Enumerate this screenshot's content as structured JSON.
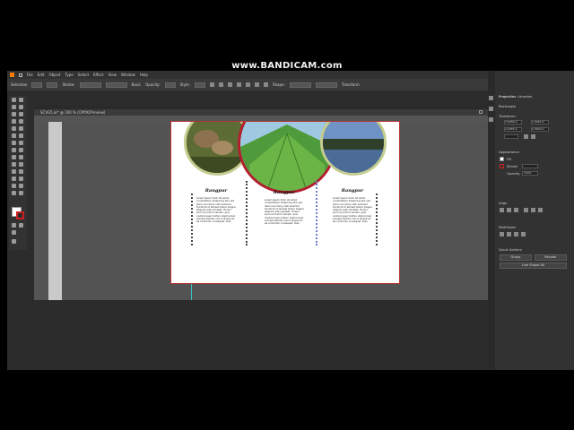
{
  "watermark": "www.BANDICAM.com",
  "menu": [
    "File",
    "Edit",
    "Object",
    "Type",
    "Select",
    "Effect",
    "View",
    "Window",
    "Help"
  ],
  "control_bar": {
    "selection": "Selection",
    "stroke": "Stroke:",
    "style": "Basic",
    "opacity": "Opacity:",
    "style_label": "Style:",
    "shape": "Shape:",
    "transform": "Transform"
  },
  "document_tab": "SCVG5.ai* @ 100 % (CMYK/Preview)",
  "artboard": {
    "columns": [
      {
        "title": "Rangpur",
        "body": "Lorem ipsum dolor sit amet, consectetuer adipiscing elit, sed diam nonummy nibh euismod tincidunt ut laoreet dolore magna aliquam erat volutpat. Ut wisi enim ad minim veniam, quis nostrud exerci tation ullamcorper suscipit lobortis nisl ut aliquip ex ea commodo consequat. Duis"
      },
      {
        "title": "Rangpur",
        "body": "Lorem ipsum dolor sit amet, consectetuer adipiscing elit, sed diam nonummy nibh euismod tincidunt ut laoreet dolore magna aliquam erat volutpat. Ut wisi enim ad minim veniam, quis nostrud exerci tation ullamcorper suscipit lobortis nisl ut aliquip ex ea commodo consequat. Duis"
      },
      {
        "title": "Rangpur",
        "body": "Lorem ipsum dolor sit amet, consectetuer adipiscing elit, sed diam nonummy nibh euismod tincidunt ut laoreet dolore magna aliquam erat volutpat. Ut wisi enim ad minim veniam, quis nostrud exerci tation ullamcorper suscipit lobortis nisl ut aliquip ex ea commodo consequat. Duis"
      }
    ]
  },
  "panel": {
    "tabs": [
      "Properties",
      "Libraries"
    ],
    "rectangle": "Rectangle",
    "transform": "Transform",
    "appearance": "Appearance",
    "fill": "Fill",
    "stroke": "Stroke",
    "opacity": "Opacity",
    "opacity_value": "100%",
    "align": "Align",
    "pathfinder": "Pathfinder",
    "quick_actions": "Quick Actions",
    "group_btn": "Group",
    "recolor_btn": "Recolor",
    "live_shape_btn": "Live Shape All",
    "w_value": "1.9063 in",
    "h_value": "2.0000 in",
    "x_value": "3.6286 in",
    "y_value": "4.9285 in"
  },
  "colors": {
    "accent_red": "#b21f2d",
    "ring_green": "#c4cc8f",
    "leaf_green": "#3f8a2e"
  }
}
